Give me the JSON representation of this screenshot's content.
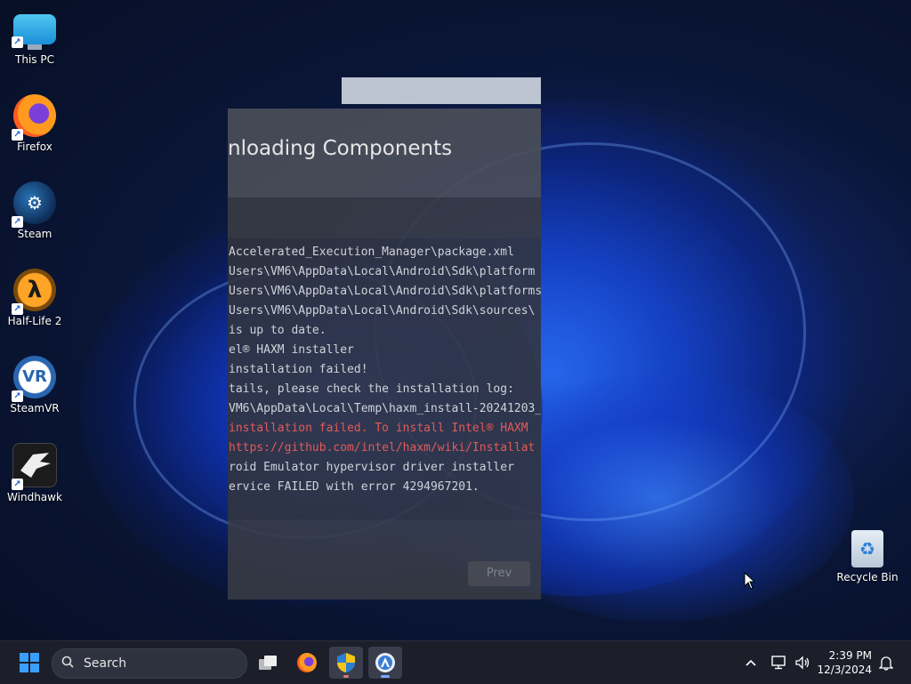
{
  "desktop": {
    "icons": [
      {
        "label": "This PC",
        "icon": "computer-icon"
      },
      {
        "label": "Firefox",
        "icon": "firefox-icon"
      },
      {
        "label": "Steam",
        "icon": "steam-icon"
      },
      {
        "label": "Half-Life 2",
        "icon": "half-life-2-icon"
      },
      {
        "label": "SteamVR",
        "icon": "steamvr-icon"
      },
      {
        "label": "Windhawk",
        "icon": "windhawk-icon"
      }
    ],
    "recycle_bin": {
      "label": "Recycle Bin",
      "icon": "recycle-bin-icon"
    }
  },
  "window": {
    "title": "nloading Components",
    "log_lines": [
      {
        "text": "Accelerated_Execution_Manager\\package.xml",
        "error": false
      },
      {
        "text": "Users\\VM6\\AppData\\Local\\Android\\Sdk\\platform",
        "error": false
      },
      {
        "text": "Users\\VM6\\AppData\\Local\\Android\\Sdk\\platforms",
        "error": false
      },
      {
        "text": "Users\\VM6\\AppData\\Local\\Android\\Sdk\\sources\\",
        "error": false
      },
      {
        "text": " is up to date.",
        "error": false
      },
      {
        "text": "el® HAXM installer",
        "error": false
      },
      {
        "text": "installation failed!",
        "error": false
      },
      {
        "text": "tails, please check the installation log:",
        "error": false
      },
      {
        "text": "VM6\\AppData\\Local\\Temp\\haxm_install-20241203_",
        "error": false
      },
      {
        "text": " installation failed. To install Intel® HAXM",
        "error": true
      },
      {
        "text": "https://github.com/intel/haxm/wiki/Installat",
        "error": true
      },
      {
        "text": "roid Emulator hypervisor driver installer",
        "error": false
      },
      {
        "text": "ervice FAILED with error 4294967201.",
        "error": false
      }
    ],
    "prev_button": "Prev"
  },
  "taskbar": {
    "search_placeholder": "Search",
    "apps": [
      "task-view-icon",
      "firefox-icon",
      "installer-shield-icon",
      "android-studio-icon"
    ],
    "time": "2:39 PM",
    "date": "12/3/2024"
  },
  "colors": {
    "accent": "#3aa0ff",
    "error_text": "#e15b5b",
    "taskbar_bg": "#1c1f2a"
  }
}
